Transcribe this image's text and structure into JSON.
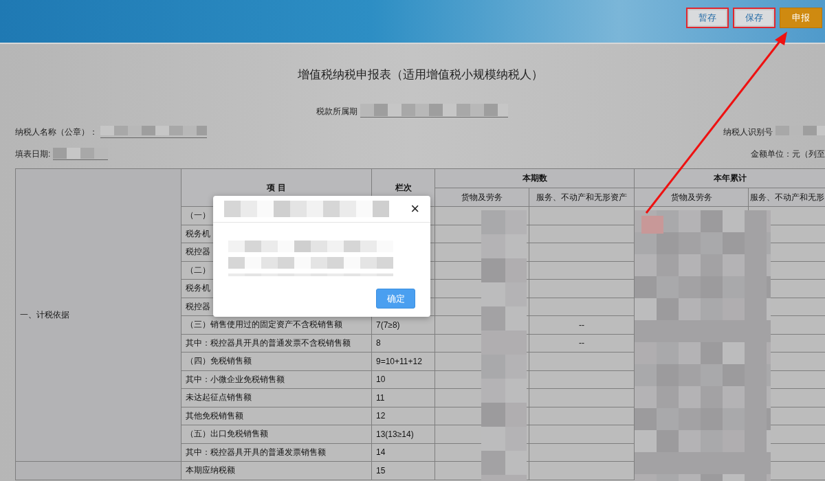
{
  "header": {
    "buttons": [
      {
        "label": "暂存",
        "kind": "plain",
        "highlighted": true
      },
      {
        "label": "保存",
        "kind": "plain",
        "highlighted": true
      },
      {
        "label": "申报",
        "kind": "primary",
        "highlighted": false
      }
    ]
  },
  "form": {
    "title": "增值税纳税申报表（适用增值税小规模纳税人）",
    "period_label": "税款所属期",
    "taxpayer_name_label": "纳税人名称（公章）：",
    "taxpayer_id_label": "纳税人识别号",
    "fill_date_label": "填表日期:",
    "unit_label": "金额单位：元（列至"
  },
  "table": {
    "item_header": "项 目",
    "no_header": "栏次",
    "current_header": "本期数",
    "ytd_header": "本年累计",
    "sub_headers": [
      "货物及劳务",
      "服务、不动产和无形资产",
      "货物及劳务",
      "服务、不动产和无形"
    ],
    "sections": [
      {
        "label": "一、计税依据",
        "rows": [
          {
            "item": "（一）"
          },
          {
            "item": "税务机"
          },
          {
            "item": "税控器"
          },
          {
            "item": "（二）"
          },
          {
            "item": "税务机"
          },
          {
            "item": "税控器"
          },
          {
            "item": "（三）销售使用过的固定资产不含税销售额",
            "no": "7(7≥8)",
            "services_current": "--"
          },
          {
            "item": "其中：税控器具开具的普通发票不含税销售额",
            "no": "8",
            "services_current": "--"
          },
          {
            "item": "（四）免税销售额",
            "no": "9=10+11+12"
          },
          {
            "item": "其中：小微企业免税销售额",
            "no": "10"
          },
          {
            "item": "未达起征点销售额",
            "no": "11"
          },
          {
            "item": "其他免税销售额",
            "no": "12"
          },
          {
            "item": "（五）出口免税销售额",
            "no": "13(13≥14)"
          },
          {
            "item": "其中：税控器具开具的普通发票销售额",
            "no": "14"
          }
        ]
      },
      {
        "rows": [
          {
            "item": "本期应纳税额",
            "no": "15"
          }
        ]
      }
    ]
  },
  "dialog": {
    "close": "×",
    "confirm": "确定"
  }
}
